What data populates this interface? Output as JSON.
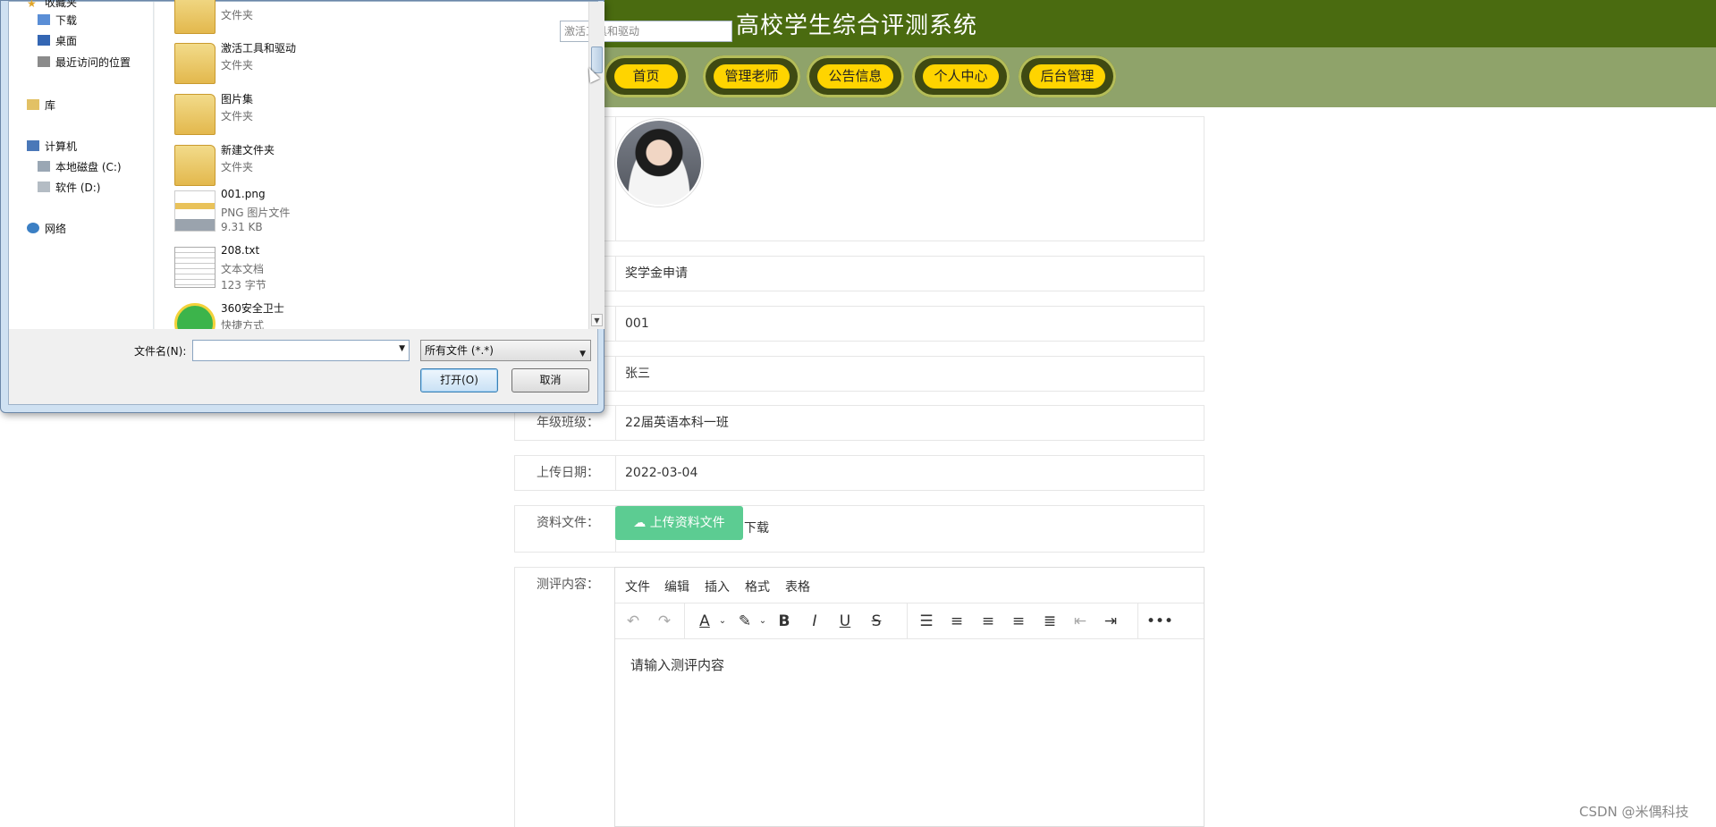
{
  "header": {
    "title": "高校学生综合评测系统"
  },
  "nav": {
    "items": [
      {
        "label": "首页"
      },
      {
        "label": "管理老师"
      },
      {
        "label": "公告信息"
      },
      {
        "label": "个人中心"
      },
      {
        "label": "后台管理"
      }
    ]
  },
  "form": {
    "field1_value": "奖学金申请",
    "field2_value": "001",
    "field3_value": "张三",
    "class_label": "年级班级：",
    "class_value": "22届英语本科一班",
    "date_label": "上传日期：",
    "date_value": "2022-03-04",
    "file_label": "资料文件：",
    "upload_label": "上传资料文件",
    "download_label": "下载",
    "content_label": "测评内容："
  },
  "editor": {
    "menu": [
      "文件",
      "编辑",
      "插入",
      "格式",
      "表格"
    ],
    "placeholder": "请输入测评内容",
    "toolbar_icons": [
      "undo-icon",
      "redo-icon",
      "font-color-icon",
      "highlight-icon",
      "bold-icon",
      "italic-icon",
      "underline-icon",
      "strikethrough-icon",
      "line-height-icon",
      "align-left-icon",
      "align-center-icon",
      "align-right-icon",
      "align-justify-icon",
      "outdent-icon",
      "indent-icon",
      "more-icon"
    ]
  },
  "dialog": {
    "tree": [
      {
        "label": "收藏夹"
      },
      {
        "label": "下载"
      },
      {
        "label": "桌面"
      },
      {
        "label": "最近访问的位置"
      },
      {
        "label": "库"
      },
      {
        "label": "计算机"
      },
      {
        "label": "本地磁盘 (C:)"
      },
      {
        "label": "软件 (D:)"
      },
      {
        "label": "网络"
      }
    ],
    "files": [
      {
        "name": "",
        "type": "文件夹",
        "size": ""
      },
      {
        "name": "激活工具和驱动",
        "type": "文件夹",
        "size": ""
      },
      {
        "name": "图片集",
        "type": "文件夹",
        "size": ""
      },
      {
        "name": "新建文件夹",
        "type": "文件夹",
        "size": ""
      },
      {
        "name": "001.png",
        "type": "PNG 图片文件",
        "size": "9.31 KB"
      },
      {
        "name": "208.txt",
        "type": "文本文档",
        "size": "123 字节"
      },
      {
        "name": "360安全卫士",
        "type": "快捷方式",
        "size": ""
      }
    ],
    "search_text": "激活工具和驱动",
    "filename_label": "文件名(N):",
    "filename_value": "",
    "filetype_value": "所有文件 (*.*)",
    "open_label": "打开(O)",
    "cancel_label": "取消"
  },
  "watermark": "CSDN @米偶科技"
}
